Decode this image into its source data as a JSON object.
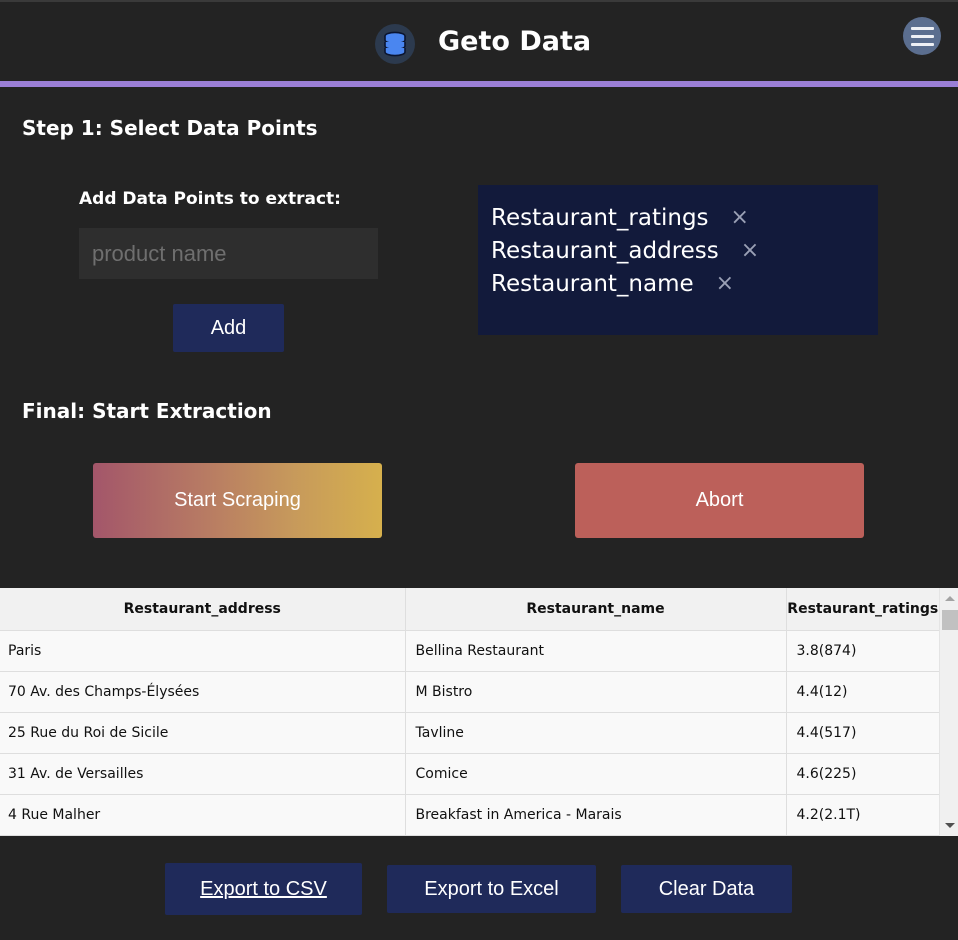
{
  "app": {
    "title": "Geto Data",
    "logo_icon": "database-icon",
    "menu_icon": "hamburger-menu-icon",
    "accent_color": "#9b7fd6"
  },
  "step1": {
    "heading": "Step 1: Select Data Points",
    "add_label": "Add Data Points to extract:",
    "input_value": "",
    "input_placeholder": "product name",
    "add_button": "Add",
    "data_points": [
      {
        "label": "Restaurant_ratings",
        "remove": "×"
      },
      {
        "label": "Restaurant_address",
        "remove": "×"
      },
      {
        "label": "Restaurant_name",
        "remove": "×"
      }
    ]
  },
  "final": {
    "heading": "Final: Start Extraction",
    "start_button": "Start Scraping",
    "abort_button": "Abort",
    "start_gradient": [
      "#a3566a",
      "#d6b04d"
    ],
    "abort_color": "#bc605a"
  },
  "table": {
    "columns": [
      "Restaurant_address",
      "Restaurant_name",
      "Restaurant_ratings"
    ],
    "rows": [
      [
        "Paris",
        "Bellina Restaurant",
        "3.8(874)"
      ],
      [
        "70 Av. des Champs-Élysées",
        "M Bistro",
        "4.4(12)"
      ],
      [
        "25 Rue du Roi de Sicile",
        "Tavline",
        "4.4(517)"
      ],
      [
        "31 Av. de Versailles",
        "Comice",
        "4.6(225)"
      ],
      [
        "4 Rue Malher",
        "Breakfast in America - Marais",
        "4.2(2.1T)"
      ]
    ]
  },
  "footer": {
    "export_csv": "Export to CSV",
    "export_excel": "Export to Excel",
    "clear_data": "Clear Data"
  }
}
